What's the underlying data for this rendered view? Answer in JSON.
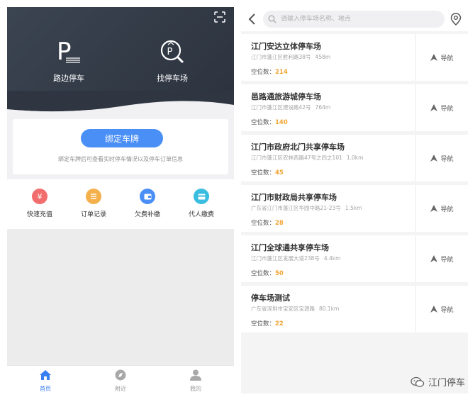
{
  "left": {
    "hero": {
      "roadside_label": "路边停车",
      "find_label": "找停车场"
    },
    "bind": {
      "button_label": "绑定车牌",
      "hint": "绑定车牌后可查看实时停车情况以及停车订单信息"
    },
    "quick_actions": [
      {
        "label": "快速充值",
        "icon": "yen-icon",
        "color": "#f26d6d"
      },
      {
        "label": "订单记录",
        "icon": "list-icon",
        "color": "#f4b04a"
      },
      {
        "label": "欠费补缴",
        "icon": "wallet-icon",
        "color": "#4a8ff5"
      },
      {
        "label": "代人缴费",
        "icon": "card-icon",
        "color": "#39bde0"
      }
    ],
    "tabs": [
      {
        "label": "首页",
        "icon": "home-icon",
        "active": true
      },
      {
        "label": "附近",
        "icon": "compass-icon",
        "active": false
      },
      {
        "label": "我的",
        "icon": "user-icon",
        "active": false
      }
    ]
  },
  "right": {
    "search_placeholder": "请输入停车场名称、地点",
    "spaces_label": "空位数：",
    "nav_label": "导航",
    "lots": [
      {
        "name": "江门安达立体停车场",
        "address": "江门市蓬江区胜利路38号",
        "distance": "458m",
        "spaces": "214"
      },
      {
        "name": "邑路通旅游城停车场",
        "address": "江门市蓬江区建设路42号",
        "distance": "764m",
        "spaces": "140"
      },
      {
        "name": "江门市政府北门共享停车场",
        "address": "江门市蓬江区农林西路47号之四之101",
        "distance": "1.0km",
        "spaces": "45"
      },
      {
        "name": "江门市财政局共享停车场",
        "address": "广东省江门市蓬江区华园中路21-23号",
        "distance": "1.5km",
        "spaces": "28"
      },
      {
        "name": "江门全球通共享停车场",
        "address": "江门市蓬江区发展大道238号",
        "distance": "4.4km",
        "spaces": "50"
      },
      {
        "name": "停车场测试",
        "address": "广东省深圳市宝安区宝源路",
        "distance": "80.1km",
        "spaces": "22"
      }
    ],
    "watermark": "江门停车"
  }
}
